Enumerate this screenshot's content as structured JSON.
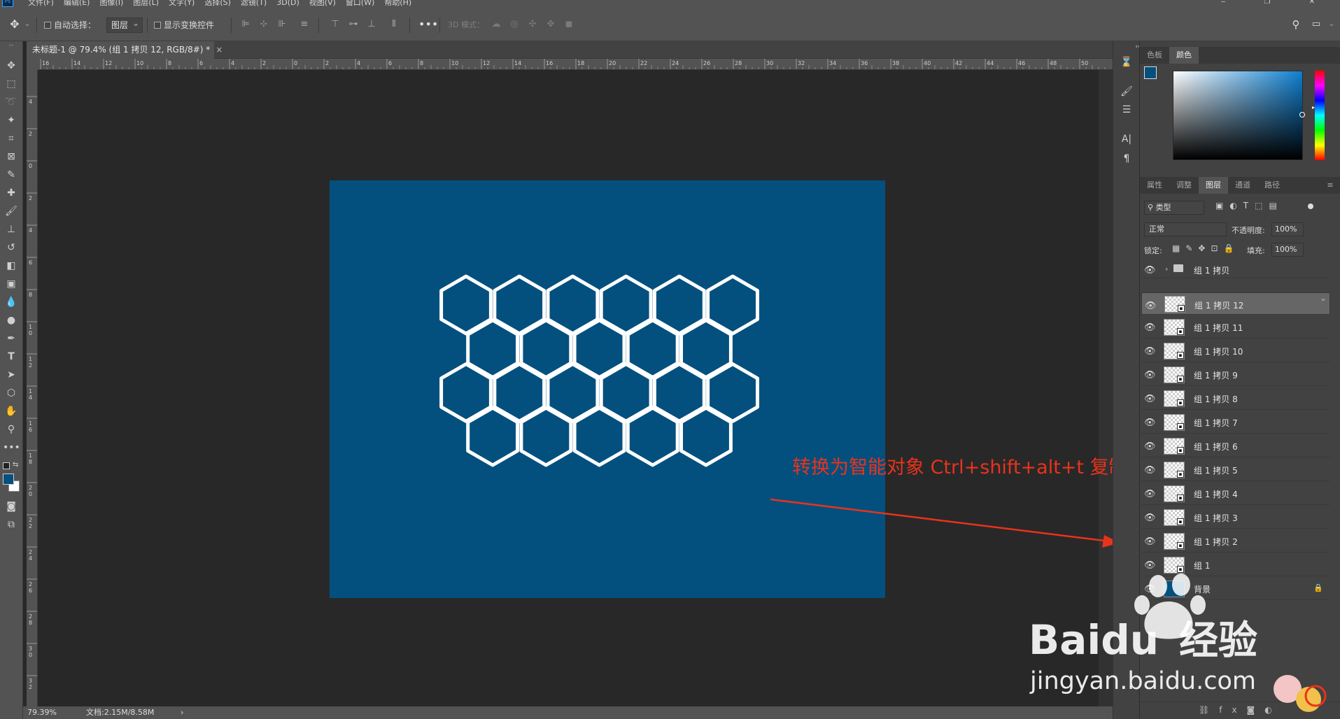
{
  "menu": [
    "文件(F)",
    "编辑(E)",
    "图像(I)",
    "图层(L)",
    "文字(Y)",
    "选择(S)",
    "滤镜(T)",
    "3D(D)",
    "视图(V)",
    "窗口(W)",
    "帮助(H)"
  ],
  "app_logo": "Ps",
  "options": {
    "auto_select_label": "自动选择：",
    "auto_select_value": "图层",
    "show_transform_label": "显示变换控件",
    "mode_3d": "3D 模式："
  },
  "document_tab": "未标题-1 @ 79.4% (组 1 拷贝 12, RGB/8#) *",
  "ruler_h": [
    "16",
    "14",
    "12",
    "10",
    "8",
    "6",
    "4",
    "2",
    "0",
    "2",
    "4",
    "6",
    "8",
    "10",
    "12",
    "14",
    "16",
    "18",
    "20",
    "22",
    "24",
    "26",
    "28",
    "30",
    "32",
    "34",
    "36",
    "38",
    "40",
    "42",
    "44",
    "46",
    "48",
    "50"
  ],
  "ruler_v": [
    "4",
    "2",
    "0",
    "2",
    "4",
    "6",
    "8",
    "1 0",
    "1 2",
    "1 4",
    "1 6",
    "1 8",
    "2 0",
    "2 2",
    "2 4",
    "2 6",
    "2 8",
    "3 0",
    "3 2"
  ],
  "status": {
    "zoom": "79.39%",
    "doc": "文档:2.15M/8.58M",
    "arrow": "›"
  },
  "annotation": "转换为智能对象 Ctrl+shift+alt+t 复制移动",
  "color_panel": {
    "tabs": [
      "色板",
      "颜色"
    ],
    "active": "颜色",
    "fg_color": "#03507f",
    "bg_color": "#ffffff"
  },
  "layers_panel": {
    "tabs": [
      "属性",
      "调整",
      "图层",
      "通道",
      "路径"
    ],
    "active": "图层",
    "filter_label": "类型",
    "blend_mode": "正常",
    "opacity_label": "不透明度:",
    "opacity_value": "100%",
    "lock_label": "锁定:",
    "fill_label": "填充:",
    "fill_value": "100%",
    "layers": [
      {
        "name": "组 1 拷贝",
        "kind": "group"
      },
      {
        "name": "组 1 拷贝 12",
        "kind": "smart",
        "selected": true
      },
      {
        "name": "组 1 拷贝 11",
        "kind": "smart"
      },
      {
        "name": "组 1 拷贝 10",
        "kind": "smart"
      },
      {
        "name": "组 1 拷贝 9",
        "kind": "smart"
      },
      {
        "name": "组 1 拷贝 8",
        "kind": "smart"
      },
      {
        "name": "组 1 拷贝 7",
        "kind": "smart"
      },
      {
        "name": "组 1 拷贝 6",
        "kind": "smart"
      },
      {
        "name": "组 1 拷贝 5",
        "kind": "smart"
      },
      {
        "name": "组 1 拷贝 4",
        "kind": "smart"
      },
      {
        "name": "组 1 拷贝 3",
        "kind": "smart"
      },
      {
        "name": "组 1 拷贝 2",
        "kind": "smart"
      },
      {
        "name": "组 1",
        "kind": "smart"
      },
      {
        "name": "背景",
        "kind": "background"
      }
    ]
  },
  "watermark": {
    "brand": "Baidu",
    "brand_cn": "经验",
    "url": "jingyan.baidu.com"
  },
  "canvas_bg_color": "#03507f",
  "hex_stroke_color": "#ffffff",
  "annotation_color": "#e8331c"
}
